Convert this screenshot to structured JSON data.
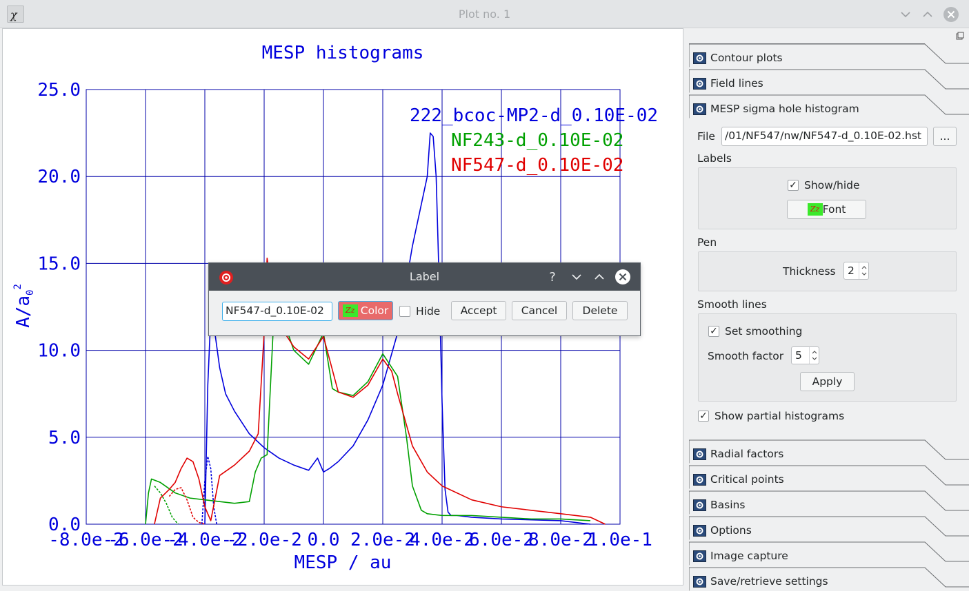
{
  "window": {
    "title": "Plot no. 1"
  },
  "plot": {
    "title": "MESP histograms",
    "xlabel": "MESP / au",
    "ylabel_main": "A/a",
    "ylabel_sub": "0",
    "ylabel_sup": "2",
    "legend": [
      {
        "text": "222_bcoc-MP2-d_0.10E-02",
        "color": "#0000dd"
      },
      {
        "text": "NF243-d_0.10E-02",
        "color": "#00a000"
      },
      {
        "text": "NF547-d_0.10E-02",
        "color": "#e00000"
      }
    ]
  },
  "chart_data": {
    "type": "line",
    "title": "MESP histograms",
    "xlabel": "MESP / au",
    "ylabel": "A/a₀²",
    "xlim": [
      -0.08,
      0.1
    ],
    "ylim": [
      0,
      25
    ],
    "grid": true,
    "x_tick_labels": [
      "-8.0e-2",
      "-6.0e-2",
      "-4.0e-2",
      "-2.0e-2",
      "0.0",
      "2.0e-2",
      "4.0e-2",
      "6.0e-2",
      "8.0e-2",
      "1.0e-1"
    ],
    "y_tick_labels": [
      "0.0",
      "5.0",
      "10.0",
      "15.0",
      "20.0",
      "25.0"
    ],
    "series": [
      {
        "name": "222_bcoc-MP2-d_0.10E-02",
        "color": "#0000dd",
        "dashed": false,
        "x": [
          -0.04,
          -0.039,
          -0.038,
          -0.037,
          -0.035,
          -0.033,
          -0.03,
          -0.025,
          -0.02,
          -0.015,
          -0.01,
          -0.005,
          -0.002,
          0.0,
          0.002,
          0.005,
          0.01,
          0.015,
          0.02,
          0.025,
          0.03,
          0.035,
          0.036,
          0.037,
          0.038,
          0.039,
          0.04,
          0.041,
          0.042,
          0.043,
          0.045,
          0.05,
          0.06,
          0.08,
          0.09
        ],
        "y": [
          0.0,
          8.0,
          12.0,
          11.5,
          9.0,
          7.5,
          6.5,
          5.2,
          4.4,
          3.8,
          3.4,
          3.1,
          3.8,
          3.0,
          3.2,
          3.6,
          4.5,
          6.0,
          8.0,
          11.0,
          16.0,
          20.0,
          22.5,
          22.3,
          20.0,
          14.0,
          7.0,
          2.0,
          0.7,
          0.5,
          0.5,
          0.4,
          0.3,
          0.2,
          0.0
        ]
      },
      {
        "name": "",
        "color": "#0000dd",
        "dashed": true,
        "x": [
          -0.041,
          -0.04,
          -0.039,
          -0.038,
          -0.037,
          -0.036
        ],
        "y": [
          0.0,
          2.5,
          3.9,
          3.2,
          1.0,
          0.0
        ]
      },
      {
        "name": "NF243-d_0.10E-02",
        "color": "#00a000",
        "dashed": false,
        "x": [
          -0.06,
          -0.059,
          -0.058,
          -0.055,
          -0.05,
          -0.045,
          -0.04,
          -0.035,
          -0.03,
          -0.025,
          -0.023,
          -0.021,
          -0.019,
          -0.017,
          -0.015,
          -0.01,
          -0.005,
          0.0,
          0.003,
          0.005,
          0.01,
          0.015,
          0.02,
          0.025,
          0.028,
          0.03,
          0.033,
          0.035,
          0.04,
          0.05,
          0.06,
          0.07,
          0.08,
          0.09
        ],
        "y": [
          0.0,
          1.8,
          2.6,
          2.4,
          1.8,
          1.5,
          1.4,
          1.3,
          1.2,
          1.3,
          3.0,
          3.8,
          4.0,
          11.0,
          12.5,
          10.0,
          9.2,
          11.0,
          7.8,
          7.6,
          7.4,
          8.2,
          9.8,
          8.5,
          5.0,
          2.2,
          0.8,
          0.6,
          0.5,
          0.5,
          0.4,
          0.3,
          0.3,
          0.2
        ]
      },
      {
        "name": "",
        "color": "#00a000",
        "dashed": true,
        "x": [
          -0.057,
          -0.055,
          -0.053,
          -0.051,
          -0.049
        ],
        "y": [
          2.2,
          1.8,
          1.2,
          0.4,
          0.0
        ]
      },
      {
        "name": "NF547-d_0.10E-02",
        "color": "#e00000",
        "dashed": false,
        "x": [
          -0.057,
          -0.055,
          -0.052,
          -0.05,
          -0.048,
          -0.046,
          -0.044,
          -0.042,
          -0.04,
          -0.038,
          -0.035,
          -0.03,
          -0.025,
          -0.022,
          -0.02,
          -0.019,
          -0.018,
          -0.015,
          -0.01,
          -0.005,
          0.0,
          0.005,
          0.01,
          0.015,
          0.02,
          0.023,
          0.025,
          0.03,
          0.035,
          0.04,
          0.05,
          0.06,
          0.07,
          0.08,
          0.09,
          0.095
        ],
        "y": [
          0.0,
          1.5,
          2.0,
          2.4,
          3.2,
          3.8,
          3.6,
          2.6,
          1.0,
          0.2,
          2.8,
          3.4,
          4.2,
          5.2,
          11.0,
          15.3,
          14.0,
          11.5,
          10.2,
          9.5,
          10.8,
          7.6,
          7.3,
          8.0,
          9.5,
          8.8,
          7.5,
          4.5,
          3.0,
          2.2,
          1.4,
          1.0,
          0.8,
          0.6,
          0.4,
          0.0
        ]
      },
      {
        "name": "",
        "color": "#e00000",
        "dashed": true,
        "x": [
          -0.052,
          -0.05,
          -0.048,
          -0.046,
          -0.044,
          -0.042,
          -0.04
        ],
        "y": [
          1.6,
          2.0,
          2.1,
          1.4,
          0.4,
          0.1,
          0.0
        ]
      }
    ]
  },
  "panel": {
    "sections_top": [
      {
        "label": "Contour plots",
        "icon": "gear-icon"
      },
      {
        "label": "Field lines",
        "icon": "gear-icon"
      },
      {
        "label": "MESP sigma hole histogram",
        "icon": "gear-icon"
      }
    ],
    "file_label": "File",
    "file_value": "/01/NF547/nw/NF547-d_0.10E-02.hst",
    "browse_label": "...",
    "labels_title": "Labels",
    "showhide_label": "Show/hide",
    "font_label": "Font",
    "pen_title": "Pen",
    "thickness_label": "Thickness",
    "thickness_value": "2",
    "smooth_title": "Smooth lines",
    "set_smoothing_label": "Set smoothing",
    "smooth_factor_label": "Smooth factor",
    "smooth_factor_value": "5",
    "apply_label": "Apply",
    "partial_label": "Show partial histograms",
    "sections_bottom": [
      {
        "label": "Radial factors",
        "icon": "gear-icon"
      },
      {
        "label": "Critical points",
        "icon": "gear-icon"
      },
      {
        "label": "Basins",
        "icon": "gear-icon"
      },
      {
        "label": "Options",
        "icon": "gear-icon"
      },
      {
        "label": "Image capture",
        "icon": "gear-icon"
      },
      {
        "label": "Save/retrieve settings",
        "icon": "gear-icon"
      }
    ]
  },
  "dialog": {
    "title": "Label",
    "help": "?",
    "input_value": "NF547-d_0.10E-02",
    "color_label": "Color",
    "hide_label": "Hide",
    "accept_label": "Accept",
    "cancel_label": "Cancel",
    "delete_label": "Delete"
  }
}
